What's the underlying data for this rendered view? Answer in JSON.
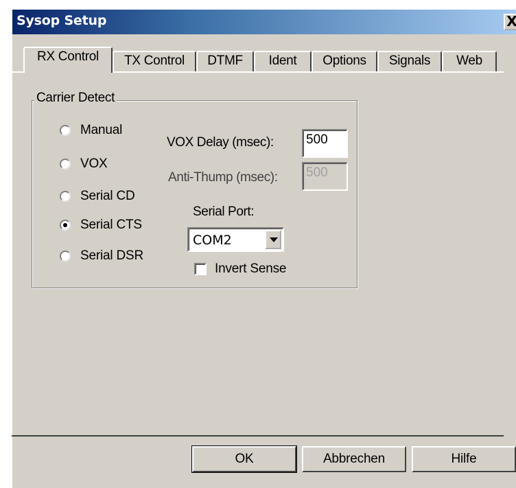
{
  "window": {
    "title": "Sysop Setup",
    "close_label": "X"
  },
  "tabs": [
    {
      "label": "RX Control",
      "active": true
    },
    {
      "label": "TX Control",
      "active": false
    },
    {
      "label": "DTMF",
      "active": false
    },
    {
      "label": "Ident",
      "active": false
    },
    {
      "label": "Options",
      "active": false
    },
    {
      "label": "Signals",
      "active": false
    },
    {
      "label": "Web",
      "active": false
    }
  ],
  "carrier_detect": {
    "legend": "Carrier Detect",
    "options": [
      {
        "label": "Manual",
        "checked": false
      },
      {
        "label": "VOX",
        "checked": false
      },
      {
        "label": "Serial CD",
        "checked": false
      },
      {
        "label": "Serial CTS",
        "checked": true
      },
      {
        "label": "Serial DSR",
        "checked": false
      }
    ]
  },
  "vox_delay": {
    "label": "VOX Delay (msec):",
    "value": "500"
  },
  "anti_thump": {
    "label": "Anti-Thump (msec):",
    "value": "500",
    "disabled": true
  },
  "serial_port": {
    "label": "Serial Port:",
    "value": "COM2"
  },
  "invert_sense": {
    "label": "Invert Sense",
    "checked": false
  },
  "buttons": {
    "ok": "OK",
    "cancel": "Abbrechen",
    "help": "Hilfe"
  }
}
